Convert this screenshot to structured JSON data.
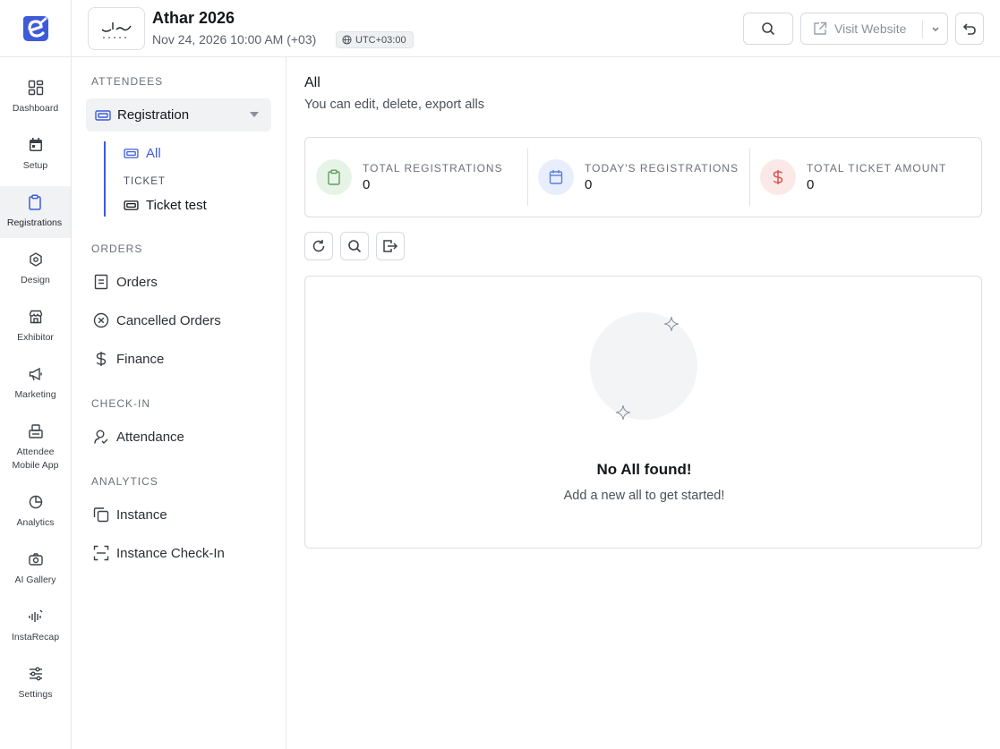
{
  "rail": {
    "items": [
      {
        "label": "Dashboard",
        "icon": "dashboard-icon"
      },
      {
        "label": "Setup",
        "icon": "calendar-icon"
      },
      {
        "label": "Registrations",
        "icon": "clipboard-icon",
        "active": true
      },
      {
        "label": "Design",
        "icon": "design-icon"
      },
      {
        "label": "Exhibitor",
        "icon": "store-icon"
      },
      {
        "label": "Marketing",
        "icon": "megaphone-icon"
      },
      {
        "label": "Attendee Mobile App",
        "icon": "mobile-app-icon"
      },
      {
        "label": "Analytics",
        "icon": "pie-chart-icon"
      },
      {
        "label": "AI Gallery",
        "icon": "camera-icon"
      },
      {
        "label": "InstaRecap",
        "icon": "audio-wave-icon"
      },
      {
        "label": "Settings",
        "icon": "sliders-icon"
      }
    ]
  },
  "header": {
    "title": "Athar 2026",
    "date": "Nov 24, 2026 10:00 AM (+03)",
    "timezone": "UTC+03:00",
    "visit_label": "Visit Website"
  },
  "subnav": {
    "attendees_title": "ATTENDEES",
    "registration_label": "Registration",
    "all_label": "All",
    "ticket_title": "TICKET",
    "ticket_label": "Ticket test",
    "orders_title": "ORDERS",
    "orders_label": "Orders",
    "cancelled_label": "Cancelled Orders",
    "finance_label": "Finance",
    "checkin_title": "CHECK-IN",
    "attendance_label": "Attendance",
    "analytics_title": "ANALYTICS",
    "instance_label": "Instance",
    "instance_checkin_label": "Instance Check-In"
  },
  "main": {
    "title": "All",
    "subtitle": "You can edit, delete, export alls",
    "stats": [
      {
        "label": "TOTAL REGISTRATIONS",
        "value": "0",
        "color": "#5aa05a"
      },
      {
        "label": "TODAY'S REGISTRATIONS",
        "value": "0",
        "color": "#5b7fd6"
      },
      {
        "label": "TOTAL TICKET AMOUNT",
        "value": "0",
        "color": "#d9534f"
      }
    ],
    "empty_title": "No All found!",
    "empty_subtitle": "Add a new all to get started!"
  },
  "colors": {
    "brand": "#3d5bd9",
    "active_bg": "#f1f2f4"
  }
}
